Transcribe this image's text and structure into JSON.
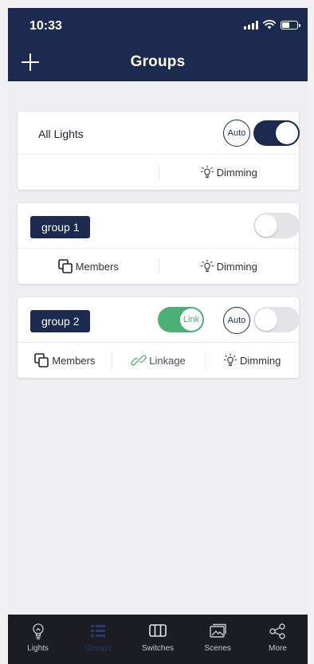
{
  "status": {
    "time": "10:33"
  },
  "header": {
    "title": "Groups"
  },
  "cards": {
    "all_lights": {
      "name": "All Lights",
      "auto_label": "Auto",
      "dimming_label": "Dimming",
      "toggle_on": true
    },
    "group1": {
      "name": "group 1",
      "members_label": "Members",
      "dimming_label": "Dimming",
      "toggle_on": false
    },
    "group2": {
      "name": "group 2",
      "link_label": "Link",
      "auto_label": "Auto",
      "members_label": "Members",
      "linkage_label": "Linkage",
      "dimming_label": "Dimming",
      "toggle_on": false,
      "link_on": true
    }
  },
  "tabbar": {
    "items": [
      {
        "label": "Lights",
        "icon": "bulb-icon"
      },
      {
        "label": "Groups",
        "icon": "groups-icon",
        "active": true
      },
      {
        "label": "Switches",
        "icon": "switches-icon"
      },
      {
        "label": "Scenes",
        "icon": "scenes-icon"
      },
      {
        "label": "More",
        "icon": "share-icon"
      }
    ]
  },
  "colors": {
    "primary": "#1b2a4e",
    "link_green": "#4caf73",
    "tabbar": "#1c1d22"
  }
}
